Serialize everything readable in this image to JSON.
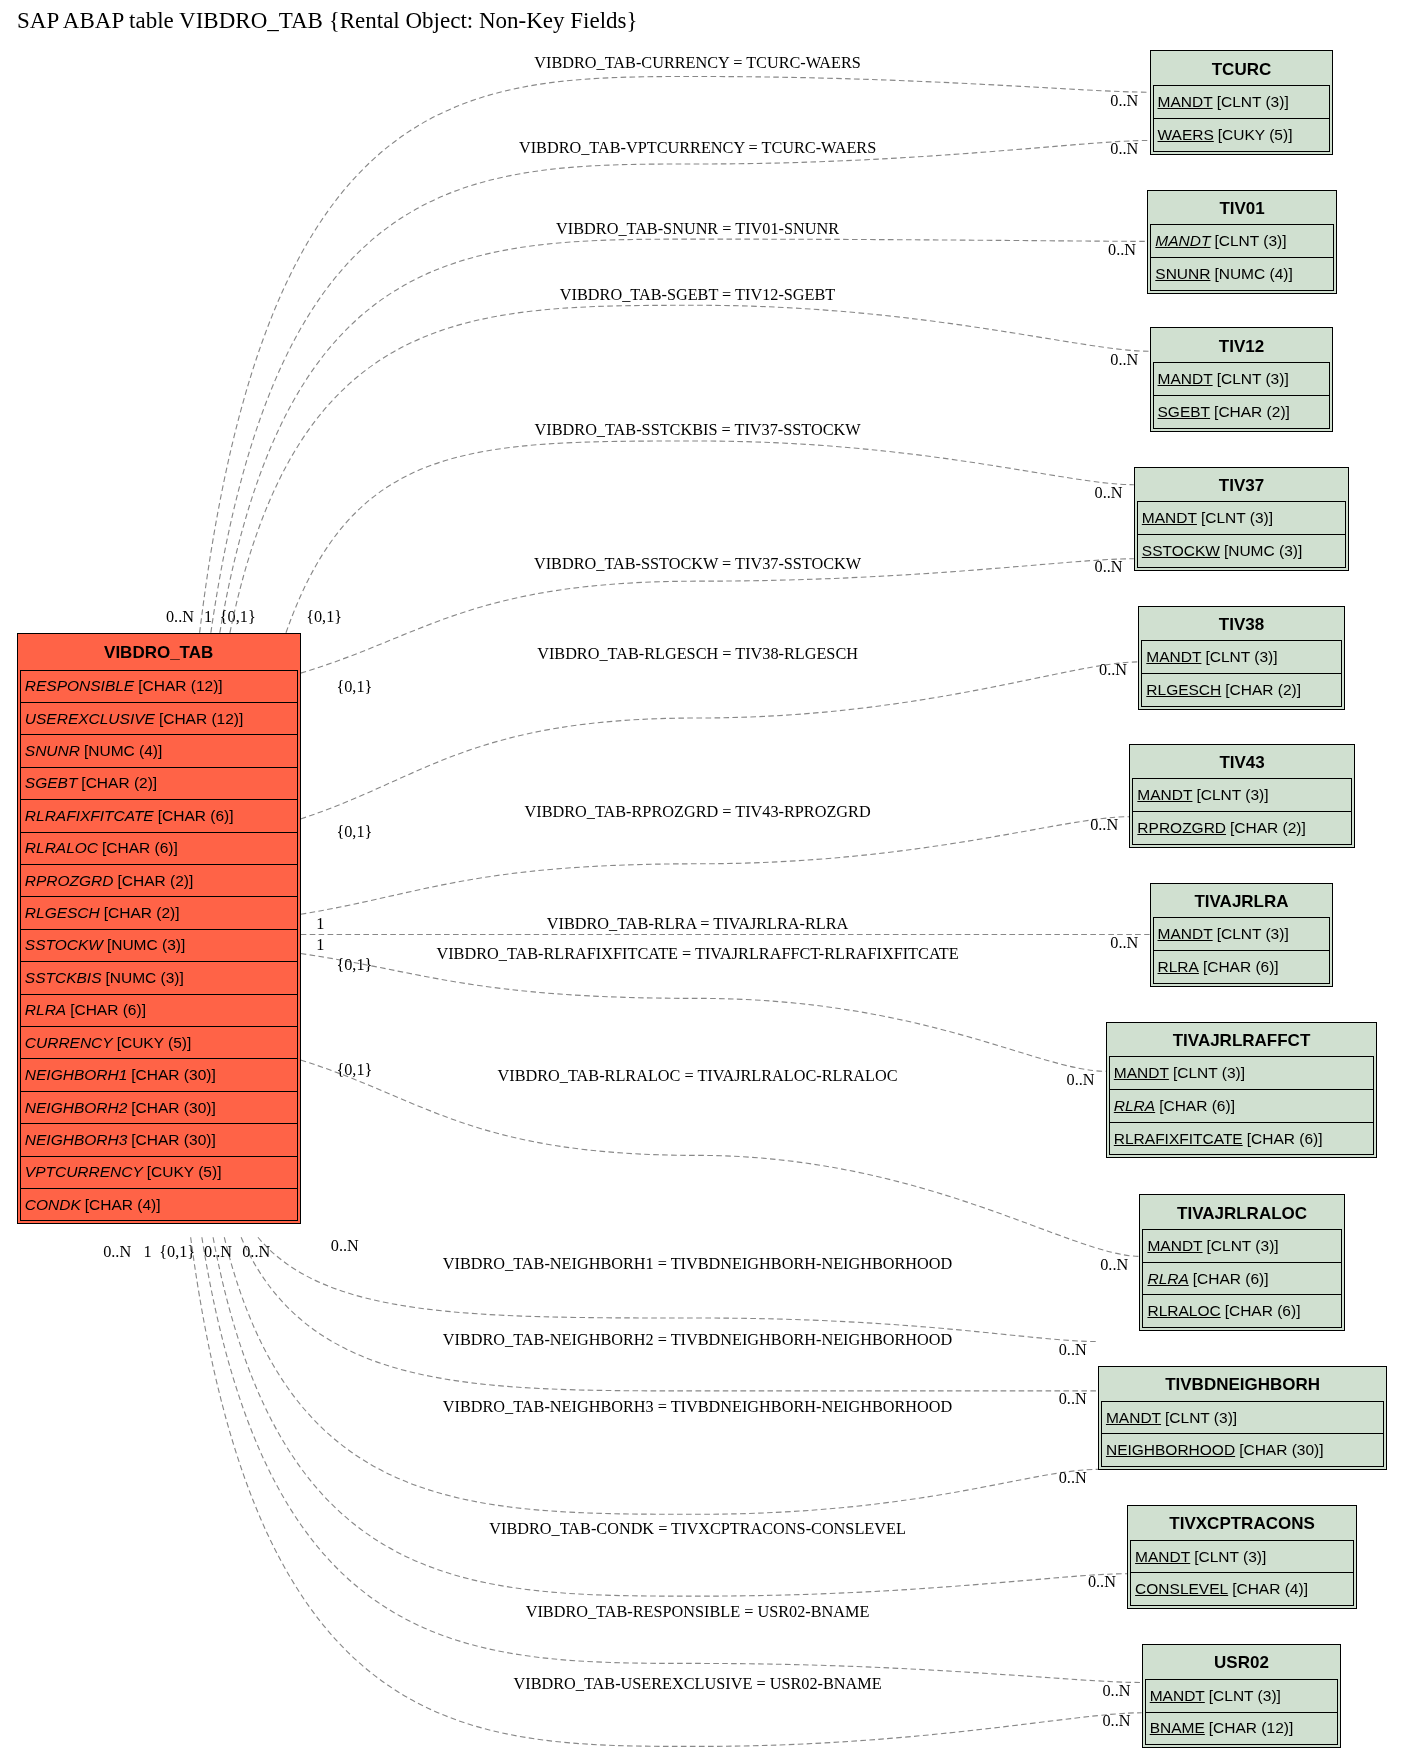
{
  "title": "SAP ABAP table VIBDRO_TAB {Rental Object: Non-Key Fields}",
  "tables": [
    {
      "name": "VIBDRO_TAB",
      "kind": "main",
      "fields": [
        {
          "name": "RESPONSIBLE",
          "type": "[CHAR (12)]",
          "italic": true,
          "key": false
        },
        {
          "name": "USEREXCLUSIVE",
          "type": "[CHAR (12)]",
          "italic": true,
          "key": false
        },
        {
          "name": "SNUNR",
          "type": "[NUMC (4)]",
          "italic": true,
          "key": false
        },
        {
          "name": "SGEBT",
          "type": "[CHAR (2)]",
          "italic": true,
          "key": false
        },
        {
          "name": "RLRAFIXFITCATE",
          "type": "[CHAR (6)]",
          "italic": true,
          "key": false
        },
        {
          "name": "RLRALOC",
          "type": "[CHAR (6)]",
          "italic": true,
          "key": false
        },
        {
          "name": "RPROZGRD",
          "type": "[CHAR (2)]",
          "italic": true,
          "key": false
        },
        {
          "name": "RLGESCH",
          "type": "[CHAR (2)]",
          "italic": true,
          "key": false
        },
        {
          "name": "SSTOCKW",
          "type": "[NUMC (3)]",
          "italic": true,
          "key": false
        },
        {
          "name": "SSTCKBIS",
          "type": "[NUMC (3)]",
          "italic": true,
          "key": false
        },
        {
          "name": "RLRA",
          "type": "[CHAR (6)]",
          "italic": true,
          "key": false
        },
        {
          "name": "CURRENCY",
          "type": "[CUKY (5)]",
          "italic": true,
          "key": false
        },
        {
          "name": "NEIGHBORH1",
          "type": "[CHAR (30)]",
          "italic": true,
          "key": false
        },
        {
          "name": "NEIGHBORH2",
          "type": "[CHAR (30)]",
          "italic": true,
          "key": false
        },
        {
          "name": "NEIGHBORH3",
          "type": "[CHAR (30)]",
          "italic": true,
          "key": false
        },
        {
          "name": "VPTCURRENCY",
          "type": "[CUKY (5)]",
          "italic": true,
          "key": false
        },
        {
          "name": "CONDK",
          "type": "[CHAR (4)]",
          "italic": true,
          "key": false
        }
      ]
    },
    {
      "name": "TCURC",
      "kind": "related",
      "fields": [
        {
          "name": "MANDT",
          "type": "[CLNT (3)]",
          "italic": false,
          "key": true
        },
        {
          "name": "WAERS",
          "type": "[CUKY (5)]",
          "italic": false,
          "key": true
        }
      ]
    },
    {
      "name": "TIV01",
      "kind": "related",
      "fields": [
        {
          "name": "MANDT",
          "type": "[CLNT (3)]",
          "italic": true,
          "key": true
        },
        {
          "name": "SNUNR",
          "type": "[NUMC (4)]",
          "italic": false,
          "key": true
        }
      ]
    },
    {
      "name": "TIV12",
      "kind": "related",
      "fields": [
        {
          "name": "MANDT",
          "type": "[CLNT (3)]",
          "italic": false,
          "key": true
        },
        {
          "name": "SGEBT",
          "type": "[CHAR (2)]",
          "italic": false,
          "key": true
        }
      ]
    },
    {
      "name": "TIV37",
      "kind": "related",
      "fields": [
        {
          "name": "MANDT",
          "type": "[CLNT (3)]",
          "italic": false,
          "key": true
        },
        {
          "name": "SSTOCKW",
          "type": "[NUMC (3)]",
          "italic": false,
          "key": true
        }
      ]
    },
    {
      "name": "TIV38",
      "kind": "related",
      "fields": [
        {
          "name": "MANDT",
          "type": "[CLNT (3)]",
          "italic": false,
          "key": true
        },
        {
          "name": "RLGESCH",
          "type": "[CHAR (2)]",
          "italic": false,
          "key": true
        }
      ]
    },
    {
      "name": "TIV43",
      "kind": "related",
      "fields": [
        {
          "name": "MANDT",
          "type": "[CLNT (3)]",
          "italic": false,
          "key": true
        },
        {
          "name": "RPROZGRD",
          "type": "[CHAR (2)]",
          "italic": false,
          "key": true
        }
      ]
    },
    {
      "name": "TIVAJRLRA",
      "kind": "related",
      "fields": [
        {
          "name": "MANDT",
          "type": "[CLNT (3)]",
          "italic": false,
          "key": true
        },
        {
          "name": "RLRA",
          "type": "[CHAR (6)]",
          "italic": false,
          "key": true
        }
      ]
    },
    {
      "name": "TIVAJRLRAFFCT",
      "kind": "related",
      "fields": [
        {
          "name": "MANDT",
          "type": "[CLNT (3)]",
          "italic": false,
          "key": true
        },
        {
          "name": "RLRA",
          "type": "[CHAR (6)]",
          "italic": true,
          "key": true
        },
        {
          "name": "RLRAFIXFITCATE",
          "type": "[CHAR (6)]",
          "italic": false,
          "key": true
        }
      ]
    },
    {
      "name": "TIVAJRLRALOC",
      "kind": "related",
      "fields": [
        {
          "name": "MANDT",
          "type": "[CLNT (3)]",
          "italic": false,
          "key": true
        },
        {
          "name": "RLRA",
          "type": "[CHAR (6)]",
          "italic": true,
          "key": true
        },
        {
          "name": "RLRALOC",
          "type": "[CHAR (6)]",
          "italic": false,
          "key": true
        }
      ]
    },
    {
      "name": "TIVBDNEIGHBORH",
      "kind": "related",
      "fields": [
        {
          "name": "MANDT",
          "type": "[CLNT (3)]",
          "italic": false,
          "key": true
        },
        {
          "name": "NEIGHBORHOOD",
          "type": "[CHAR (30)]",
          "italic": false,
          "key": true
        }
      ]
    },
    {
      "name": "TIVXCPTRACONS",
      "kind": "related",
      "fields": [
        {
          "name": "MANDT",
          "type": "[CLNT (3)]",
          "italic": false,
          "key": true
        },
        {
          "name": "CONSLEVEL",
          "type": "[CHAR (4)]",
          "italic": false,
          "key": true
        }
      ]
    },
    {
      "name": "USR02",
      "kind": "related",
      "fields": [
        {
          "name": "MANDT",
          "type": "[CLNT (3)]",
          "italic": false,
          "key": true
        },
        {
          "name": "BNAME",
          "type": "[CHAR (12)]",
          "italic": false,
          "key": true
        }
      ]
    }
  ],
  "relations": [
    {
      "label": "VIBDRO_TAB-CURRENCY = TCURC-WAERS",
      "source_cardinality": "0..N",
      "target_cardinality": "0..N"
    },
    {
      "label": "VIBDRO_TAB-VPTCURRENCY = TCURC-WAERS",
      "source_cardinality": "1",
      "target_cardinality": "0..N"
    },
    {
      "label": "VIBDRO_TAB-SNUNR = TIV01-SNUNR",
      "source_cardinality": "{0,1}",
      "target_cardinality": "0..N"
    },
    {
      "label": "VIBDRO_TAB-SGEBT = TIV12-SGEBT",
      "target_cardinality": "0..N"
    },
    {
      "label": "VIBDRO_TAB-SSTCKBIS = TIV37-SSTOCKW",
      "source_cardinality": "{0,1}",
      "target_cardinality": "0..N"
    },
    {
      "label": "VIBDRO_TAB-SSTOCKW = TIV37-SSTOCKW",
      "source_cardinality": "{0,1}",
      "target_cardinality": "0..N"
    },
    {
      "label": "VIBDRO_TAB-RLGESCH = TIV38-RLGESCH",
      "source_cardinality": "{0,1}",
      "target_cardinality": "0..N"
    },
    {
      "label": "VIBDRO_TAB-RPROZGRD = TIV43-RPROZGRD",
      "source_cardinality": "1",
      "target_cardinality": "0..N"
    },
    {
      "label": "VIBDRO_TAB-RLRA = TIVAJRLRA-RLRA",
      "source_cardinality": "1",
      "target_cardinality": "0..N"
    },
    {
      "label": "VIBDRO_TAB-RLRAFIXFITCATE = TIVAJRLRAFFCT-RLRAFIXFITCATE",
      "source_cardinality": "{0,1}",
      "target_cardinality": "0..N"
    },
    {
      "label": "VIBDRO_TAB-RLRALOC = TIVAJRLRALOC-RLRALOC",
      "source_cardinality": "{0,1}",
      "target_cardinality": "0..N"
    },
    {
      "label": "VIBDRO_TAB-NEIGHBORH1 = TIVBDNEIGHBORH-NEIGHBORHOOD",
      "source_cardinality": "0..N",
      "target_cardinality": "0..N"
    },
    {
      "label": "VIBDRO_TAB-NEIGHBORH2 = TIVBDNEIGHBORH-NEIGHBORHOOD",
      "source_cardinality": "0..N",
      "target_cardinality": "0..N"
    },
    {
      "label": "VIBDRO_TAB-NEIGHBORH3 = TIVBDNEIGHBORH-NEIGHBORHOOD",
      "source_cardinality": "1",
      "target_cardinality": "0..N"
    },
    {
      "label": "VIBDRO_TAB-CONDK = TIVXCPTRACONS-CONSLEVEL",
      "source_cardinality": "{0,1}",
      "target_cardinality": "0..N"
    },
    {
      "label": "VIBDRO_TAB-RESPONSIBLE = USR02-BNAME",
      "source_cardinality": "0..N",
      "target_cardinality": "0..N"
    },
    {
      "label": "VIBDRO_TAB-USEREXCLUSIVE = USR02-BNAME",
      "source_cardinality": "0..N",
      "target_cardinality": "0..N"
    }
  ]
}
